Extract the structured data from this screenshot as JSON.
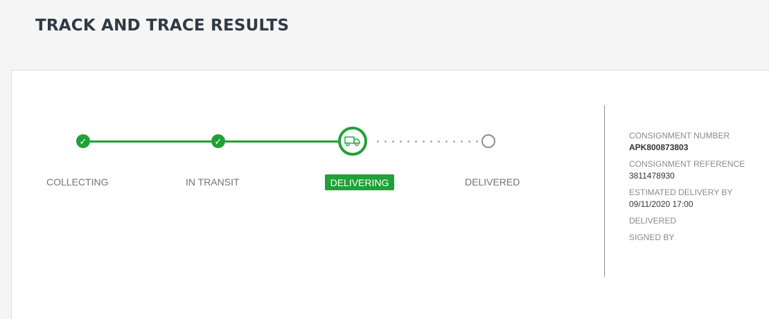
{
  "header": {
    "title": "TRACK AND TRACE RESULTS"
  },
  "tracker": {
    "steps": [
      {
        "label": "COLLECTING",
        "state": "done"
      },
      {
        "label": "IN TRANSIT",
        "state": "done"
      },
      {
        "label": "DELIVERING",
        "state": "current"
      },
      {
        "label": "DELIVERED",
        "state": "pending"
      }
    ],
    "check_glyph": "✓",
    "accent_color": "#21a038"
  },
  "details": {
    "consignment_number_label": "CONSIGNMENT NUMBER",
    "consignment_number": "APK800873803",
    "consignment_reference_label": "CONSIGNMENT REFERENCE",
    "consignment_reference": "3811478930",
    "estimated_delivery_label": "ESTIMATED DELIVERY BY",
    "estimated_delivery": "09/11/2020 17:00",
    "delivered_label": "DELIVERED",
    "signed_by_label": "SIGNED BY"
  }
}
